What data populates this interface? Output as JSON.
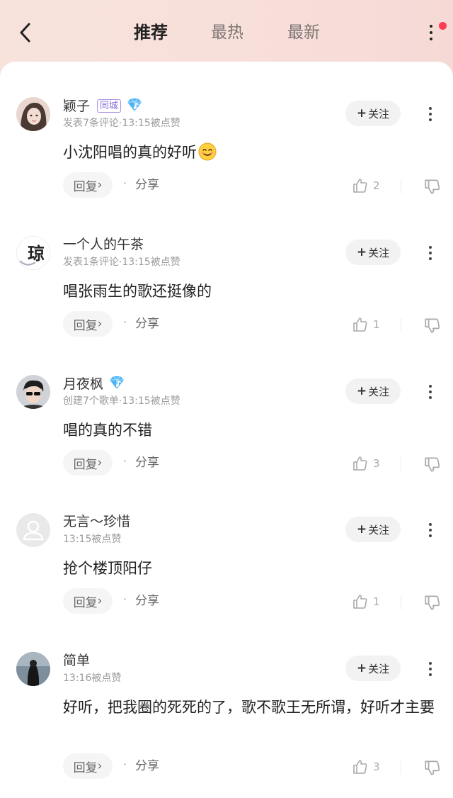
{
  "header": {
    "tabs": [
      {
        "label": "推荐",
        "active": true
      },
      {
        "label": "最热",
        "active": false
      },
      {
        "label": "最新",
        "active": false
      }
    ],
    "back_icon": "chevron-left-icon",
    "more_icon": "more-vertical-icon",
    "notification_dot_color": "#ff3b4f"
  },
  "comments": [
    {
      "name": "颖子",
      "badge_city": "同城",
      "vip": true,
      "meta": "发表7条评论·13:15被点赞",
      "follow": "关注",
      "text": "小沈阳唱的真的好听",
      "emoji": "smiling-face-icon",
      "reply": "回复",
      "share": "分享",
      "likes": "2"
    },
    {
      "name": "一个人的午茶",
      "avatar_text": "琼",
      "meta": "发表1条评论·13:15被点赞",
      "follow": "关注",
      "text": "唱张雨生的歌还挺像的",
      "reply": "回复",
      "share": "分享",
      "likes": "1"
    },
    {
      "name": "月夜枫",
      "vip": true,
      "meta": "创建7个歌单·13:15被点赞",
      "follow": "关注",
      "text": "唱的真的不错",
      "reply": "回复",
      "share": "分享",
      "likes": "3"
    },
    {
      "name": "无言～珍惜",
      "meta": "13:15被点赞",
      "follow": "关注",
      "text": "抢个楼顶阳仔",
      "reply": "回复",
      "share": "分享",
      "likes": "1"
    },
    {
      "name": "简单",
      "meta": "13:16被点赞",
      "follow": "关注",
      "text": "好听，把我圈的死死的了，歌不歌王无所谓，好听才主要",
      "reply": "回复",
      "share": "分享",
      "likes": "3"
    }
  ]
}
